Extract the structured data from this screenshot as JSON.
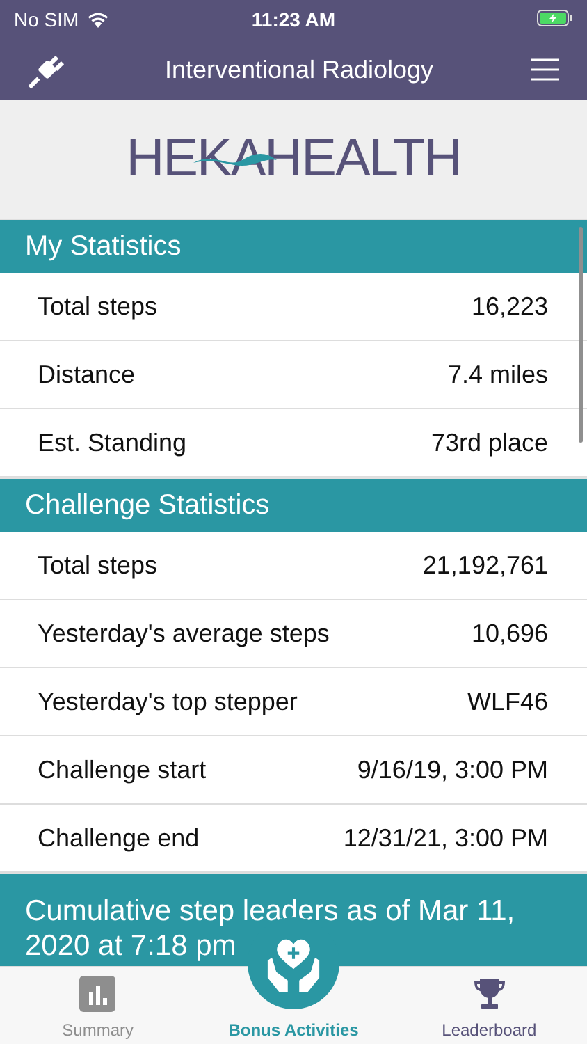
{
  "status_bar": {
    "carrier": "No SIM",
    "time": "11:23 AM"
  },
  "nav_bar": {
    "title": "Interventional Radiology"
  },
  "logo": {
    "text": "HEKAHEALTH"
  },
  "sections": [
    {
      "title": "My Statistics",
      "rows": [
        {
          "label": "Total steps",
          "value": "16,223"
        },
        {
          "label": "Distance",
          "value": "7.4 miles"
        },
        {
          "label": "Est. Standing",
          "value": "73rd place"
        }
      ]
    },
    {
      "title": "Challenge Statistics",
      "rows": [
        {
          "label": "Total steps",
          "value": "21,192,761"
        },
        {
          "label": "Yesterday's average steps",
          "value": "10,696"
        },
        {
          "label": "Yesterday's top stepper",
          "value": "WLF46"
        },
        {
          "label": "Challenge start",
          "value": "9/16/19, 3:00 PM"
        },
        {
          "label": "Challenge end",
          "value": "12/31/21, 3:00 PM"
        }
      ]
    },
    {
      "title": "Cumulative step leaders as of Mar 11, 2020 at 7:18 pm"
    }
  ],
  "tabs": [
    {
      "label": "Summary",
      "kind": "chart",
      "selected": false,
      "color": "#8e8e8e"
    },
    {
      "label": "Bonus Activities",
      "kind": "hands",
      "selected": true,
      "color": "#2a97a3"
    },
    {
      "label": "Leaderboard",
      "kind": "trophy",
      "selected": false,
      "color": "#575279"
    }
  ]
}
